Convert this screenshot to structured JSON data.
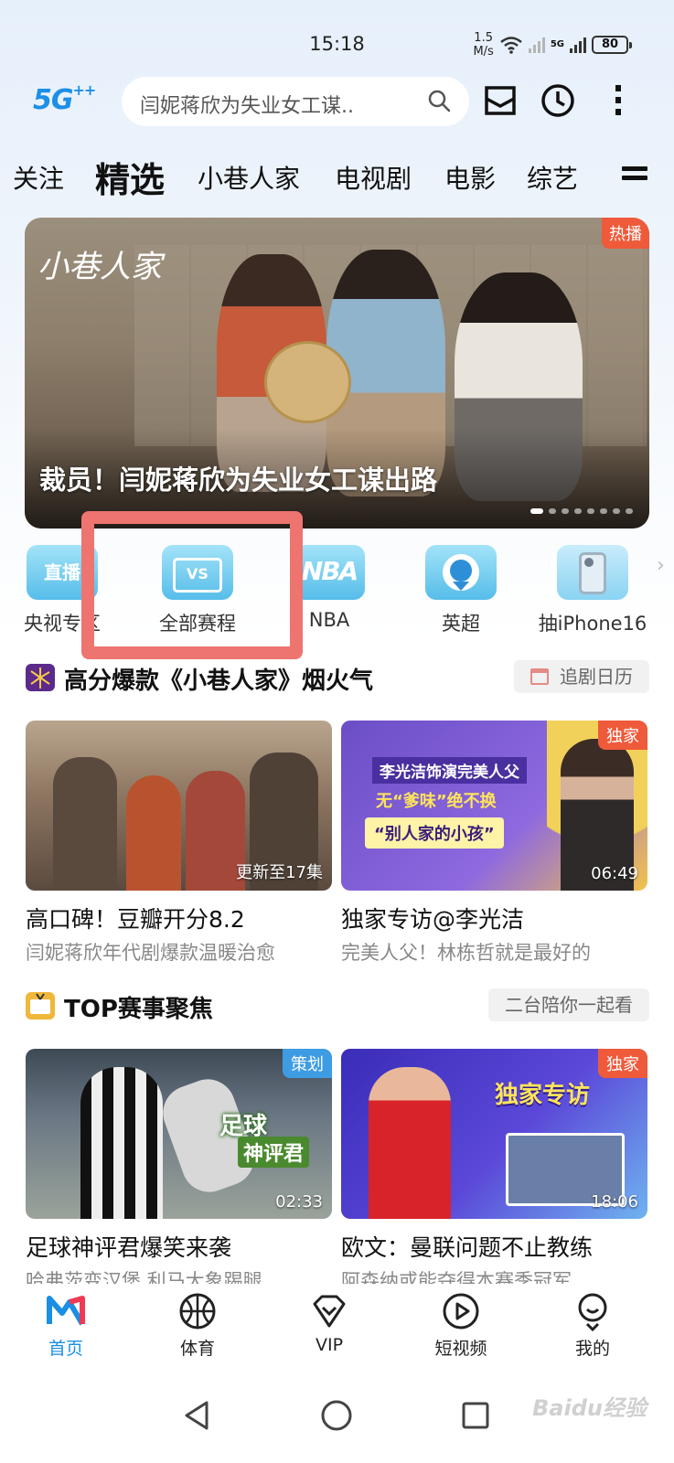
{
  "status_bar": {
    "time": "15:18",
    "net_speed_value": "1.5",
    "net_speed_unit": "M/s",
    "network_label": "5G",
    "battery": "80"
  },
  "header": {
    "logo": "5G",
    "logo_suffix": "++",
    "search_placeholder": "闫妮蒋欣为失业女工谋..",
    "icons": [
      "search-icon",
      "inbox-icon",
      "history-clock-icon",
      "more-vertical-icon"
    ]
  },
  "tabs": {
    "items": [
      "关注",
      "精选",
      "小巷人家",
      "电视剧",
      "电影",
      "综艺"
    ],
    "active_index": 1
  },
  "banner": {
    "logo_text": "小巷人家",
    "badge": "热播",
    "caption": "裁员！闫妮蒋欣为失业女工谋出路",
    "page_count": 8,
    "active_page": 0
  },
  "quick_entries": [
    {
      "label": "央视专区",
      "icon": "live-tv-icon",
      "icon_text": "直播"
    },
    {
      "label": "全部赛程",
      "icon": "schedule-calendar-icon",
      "icon_text": "VS"
    },
    {
      "label": "NBA",
      "icon": "nba-icon",
      "icon_text": "NBA"
    },
    {
      "label": "英超",
      "icon": "premier-league-lion-icon",
      "icon_text": ""
    },
    {
      "label": "抽iPhone16",
      "icon": "phone-gift-icon",
      "icon_text": ""
    }
  ],
  "section1": {
    "title": "高分爆款《小巷人家》烟火气",
    "button": "追剧日历",
    "cards": [
      {
        "title": "高口碑！豆瓣开分8.2",
        "subtitle": "闫妮蒋欣年代剧爆款温暖治愈",
        "overlay": "更新至17集",
        "badge": ""
      },
      {
        "title": "独家专访@李光洁",
        "subtitle": "完美人父！林栋哲就是最好的",
        "overlay": "06:49",
        "badge": "独家",
        "thumb_lines": [
          "李光洁饰演完美人父",
          "无“爹味”绝不换",
          "“别人家的小孩”"
        ]
      }
    ]
  },
  "section2": {
    "title": "TOP赛事聚焦",
    "button": "二台陪你一起看",
    "cards": [
      {
        "title": "足球神评君爆笑来袭",
        "subtitle": "哈弗茨变汉堡 利马大象踢腿",
        "overlay": "02:33",
        "badge": "策划",
        "thumb_lines": [
          "足球",
          "神评君"
        ]
      },
      {
        "title": "欧文：曼联问题不止教练",
        "subtitle": "阿森纳或能夺得本赛季冠军",
        "overlay": "18:06",
        "badge": "独家",
        "thumb_lines": [
          "独家专访"
        ]
      }
    ]
  },
  "bottom_nav": [
    {
      "label": "首页",
      "icon": "home-logo-icon",
      "active": true
    },
    {
      "label": "体育",
      "icon": "basketball-icon",
      "active": false
    },
    {
      "label": "VIP",
      "icon": "vip-diamond-icon",
      "active": false
    },
    {
      "label": "短视频",
      "icon": "play-circle-icon",
      "active": false
    },
    {
      "label": "我的",
      "icon": "profile-icon",
      "active": false
    }
  ],
  "system_nav": [
    "back-icon",
    "home-circle-icon",
    "recents-square-icon"
  ],
  "watermark": "Baidu经验",
  "colors": {
    "accent": "#1a8fe3",
    "hot_badge": "#ef5a3a",
    "highlight": "#ee7470"
  }
}
